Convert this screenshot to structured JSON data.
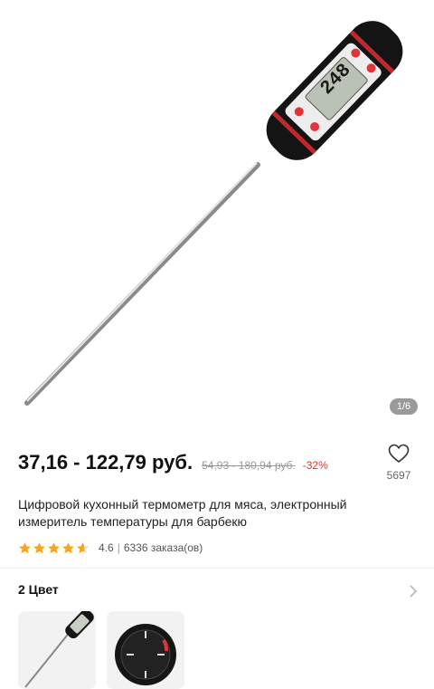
{
  "gallery": {
    "counter": "1/6",
    "lcd_reading": "248"
  },
  "product": {
    "price": "37,16 - 122,79 руб.",
    "old_price": "54,93 - 180,94 руб.",
    "discount": "-32%",
    "title": "Цифровой кухонный термометр для мяса, электронный измеритель температуры для барбекю",
    "rating": "4.6",
    "separator": "|",
    "orders": "6336 заказа(ов)"
  },
  "favorites": {
    "count": "5697",
    "icon": "heart-outline-icon"
  },
  "colors": {
    "title": "2 Цвет",
    "chevron_icon": "chevron-right-icon",
    "options": [
      "probe-thermometer",
      "dial-thermometer"
    ]
  },
  "theme": {
    "star_color": "#f5a623",
    "discount_color": "#e5342b",
    "probe_red": "#e0343a"
  }
}
